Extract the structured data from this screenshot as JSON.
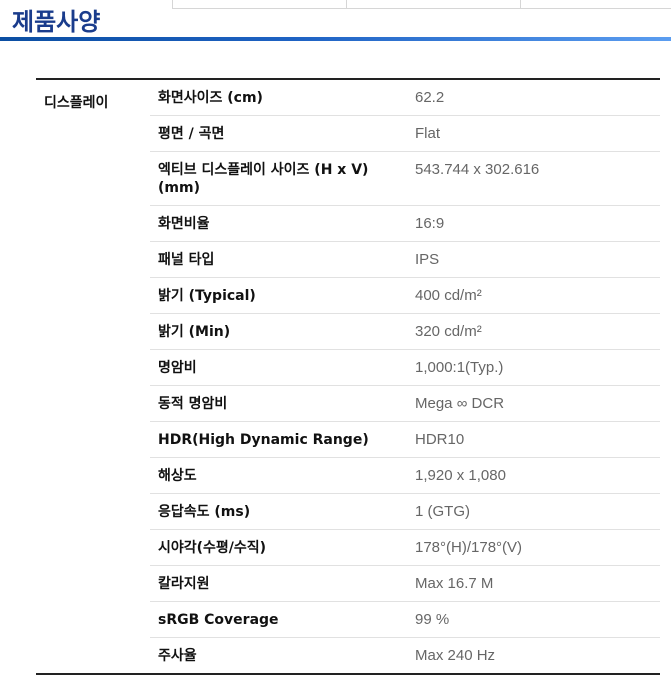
{
  "page": {
    "title": "제품사양"
  },
  "section": {
    "label": "디스플레이",
    "rows": [
      {
        "key": "화면사이즈 (cm)",
        "value": "62.2"
      },
      {
        "key": "평면 / 곡면",
        "value": "Flat"
      },
      {
        "key": "엑티브 디스플레이 사이즈 (H x V) (mm)",
        "value": "543.744 x 302.616"
      },
      {
        "key": "화면비율",
        "value": "16:9"
      },
      {
        "key": "패널 타입",
        "value": "IPS"
      },
      {
        "key": "밝기 (Typical)",
        "value": "400 cd/m²"
      },
      {
        "key": "밝기 (Min)",
        "value": "320 cd/m²"
      },
      {
        "key": "명암비",
        "value": "1,000:1(Typ.)"
      },
      {
        "key": "동적 명암비",
        "value": "Mega ∞ DCR"
      },
      {
        "key": "HDR(High Dynamic Range)",
        "value": "HDR10"
      },
      {
        "key": "해상도",
        "value": "1,920 x 1,080"
      },
      {
        "key": "응답속도 (ms)",
        "value": "1 (GTG)"
      },
      {
        "key": "시야각(수평/수직)",
        "value": "178°(H)/178°(V)"
      },
      {
        "key": "칼라지원",
        "value": "Max 16.7 M"
      },
      {
        "key": "sRGB Coverage",
        "value": "99 %"
      },
      {
        "key": "주사율",
        "value": "Max 240 Hz"
      }
    ]
  }
}
